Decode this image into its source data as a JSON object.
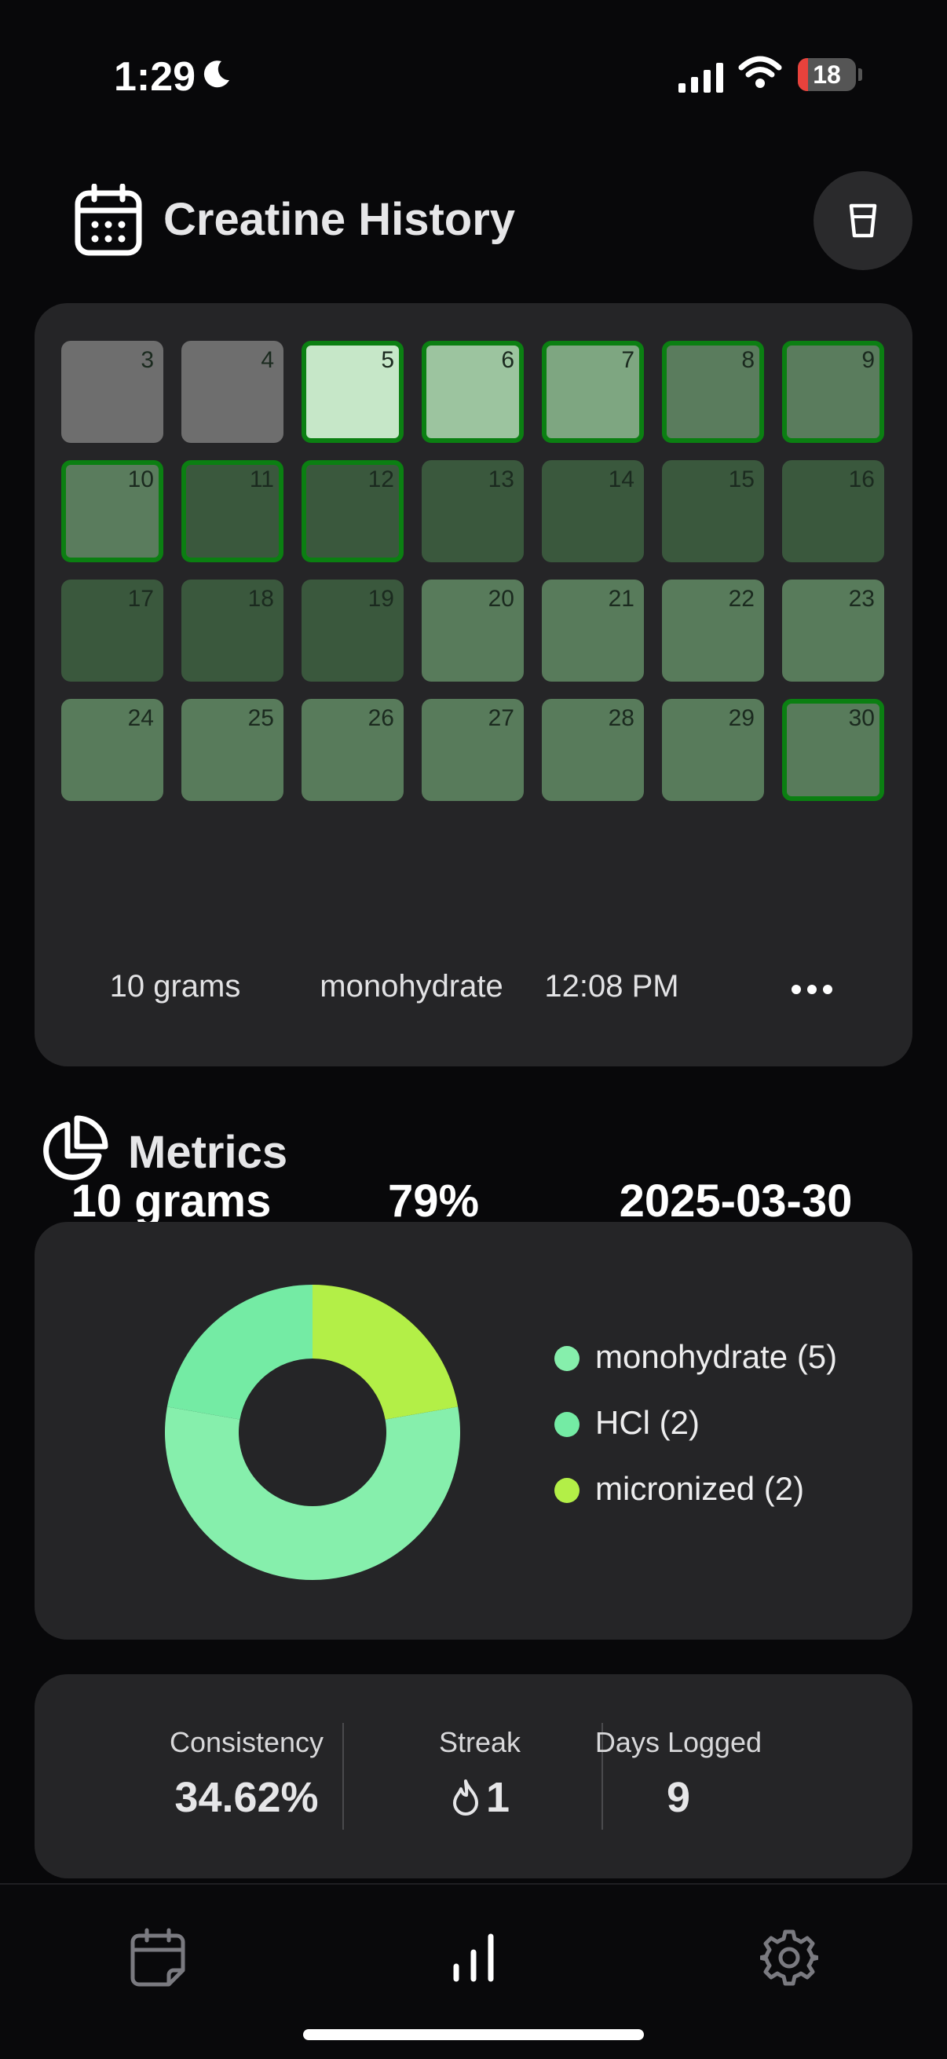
{
  "status_bar": {
    "time": "1:29",
    "battery_level": "18",
    "battery_fraction": 0.18,
    "icons": [
      "moon-icon",
      "signal-icon",
      "wifi-icon",
      "battery-icon"
    ]
  },
  "header": {
    "title": "Creatine History",
    "icon": "calendar-icon",
    "action_icon": "glass-icon"
  },
  "calendar": {
    "days": [
      {
        "day": "3",
        "color": "#6e6e6e",
        "logged": false
      },
      {
        "day": "4",
        "color": "#6e6e6e",
        "logged": false
      },
      {
        "day": "5",
        "color": "#c6e7c8",
        "logged": true
      },
      {
        "day": "6",
        "color": "#9cc49f",
        "logged": true
      },
      {
        "day": "7",
        "color": "#7ea681",
        "logged": true
      },
      {
        "day": "8",
        "color": "#5a7c5d",
        "logged": true
      },
      {
        "day": "9",
        "color": "#5a7c5d",
        "logged": true
      },
      {
        "day": "10",
        "color": "#5a7c5d",
        "logged": true
      },
      {
        "day": "11",
        "color": "#3a583d",
        "logged": true
      },
      {
        "day": "12",
        "color": "#3a583d",
        "logged": true
      },
      {
        "day": "13",
        "color": "#3a583d",
        "logged": false
      },
      {
        "day": "14",
        "color": "#3a583d",
        "logged": false
      },
      {
        "day": "15",
        "color": "#3a583d",
        "logged": false
      },
      {
        "day": "16",
        "color": "#3a583d",
        "logged": false
      },
      {
        "day": "17",
        "color": "#3a583d",
        "logged": false
      },
      {
        "day": "18",
        "color": "#3a583d",
        "logged": false
      },
      {
        "day": "19",
        "color": "#3a583d",
        "logged": false
      },
      {
        "day": "20",
        "color": "#587b5b",
        "logged": false
      },
      {
        "day": "21",
        "color": "#587b5b",
        "logged": false
      },
      {
        "day": "22",
        "color": "#587b5b",
        "logged": false
      },
      {
        "day": "23",
        "color": "#587b5b",
        "logged": false
      },
      {
        "day": "24",
        "color": "#587b5b",
        "logged": false
      },
      {
        "day": "25",
        "color": "#587b5b",
        "logged": false
      },
      {
        "day": "26",
        "color": "#587b5b",
        "logged": false
      },
      {
        "day": "27",
        "color": "#587b5b",
        "logged": false
      },
      {
        "day": "28",
        "color": "#587b5b",
        "logged": false
      },
      {
        "day": "29",
        "color": "#587b5b",
        "logged": false
      },
      {
        "day": "30",
        "color": "#587b5b",
        "logged": true
      }
    ],
    "selected_entry": {
      "amount": "10 grams",
      "percent": "79%",
      "date": "2025-03-30",
      "dose": "10 grams",
      "type": "monohydrate",
      "time": "12:08 PM"
    }
  },
  "metrics": {
    "title": "Metrics",
    "icon": "pie-chart-icon",
    "chart_data": {
      "type": "pie",
      "series": [
        {
          "name": "monohydrate (5)",
          "value": 5,
          "color": "#86efac"
        },
        {
          "name": "HCl (2)",
          "value": 2,
          "color": "#74eba4"
        },
        {
          "name": "micronized (2)",
          "value": 2,
          "color": "#b3ef47"
        }
      ]
    }
  },
  "summary": {
    "consistency_label": "Consistency",
    "consistency_value": "34.62%",
    "streak_label": "Streak",
    "streak_value": "1",
    "days_logged_label": "Days Logged",
    "days_logged_value": "9"
  },
  "tab_bar": {
    "tabs": [
      "calendar-edit-icon",
      "bar-chart-icon",
      "settings-gear-icon"
    ],
    "active": "bar-chart-icon"
  },
  "colors": {
    "background": "#08080a",
    "card": "#252527",
    "logged_border": "#0b7f12"
  }
}
